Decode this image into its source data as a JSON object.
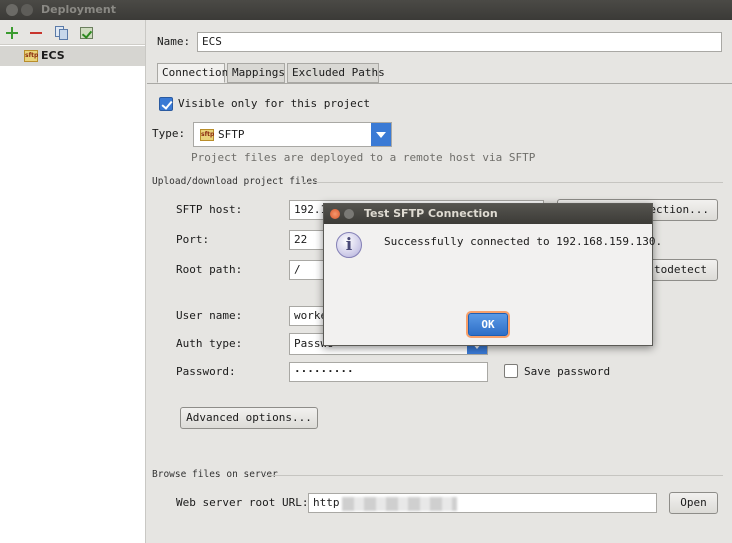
{
  "window": {
    "title": "Deployment"
  },
  "sidebar": {
    "items": [
      {
        "label": "ECS",
        "icon": "sftp-icon"
      }
    ]
  },
  "form": {
    "name_label": "Name:",
    "name_value": "ECS",
    "tabs": [
      {
        "label": "Connection",
        "active": true
      },
      {
        "label": "Mappings"
      },
      {
        "label": "Excluded Paths"
      }
    ],
    "visible_only_label": "Visible only for this project",
    "visible_only_checked": true,
    "type_label": "Type:",
    "type_value": "SFTP",
    "type_hint": "Project files are deployed to a remote host via SFTP",
    "section_upload": "Upload/download project files",
    "sftp_host_label": "SFTP host:",
    "sftp_host_value": "192.1",
    "test_connection_label": "ection...",
    "port_label": "Port:",
    "port_value": "22",
    "root_path_label": "Root path:",
    "root_path_value": "/",
    "autodetect_label": "utodetect",
    "user_name_label": "User name:",
    "user_name_value": "worke",
    "auth_type_label": "Auth type:",
    "auth_type_value": "Passwo",
    "password_label": "Password:",
    "password_value": "·········",
    "save_password_label": "Save password",
    "advanced_options_label": "Advanced options...",
    "section_browse": "Browse files on server",
    "web_root_label": "Web server root URL:",
    "web_root_value": "http",
    "open_label": "Open"
  },
  "dialog": {
    "title": "Test SFTP Connection",
    "message": "Successfully connected to 192.168.159.130.",
    "ok_label": "OK"
  },
  "colors": {
    "accent": "#3a7ad5",
    "titlebar": "#3c3b37",
    "ok_focus": "#f7a06b"
  }
}
